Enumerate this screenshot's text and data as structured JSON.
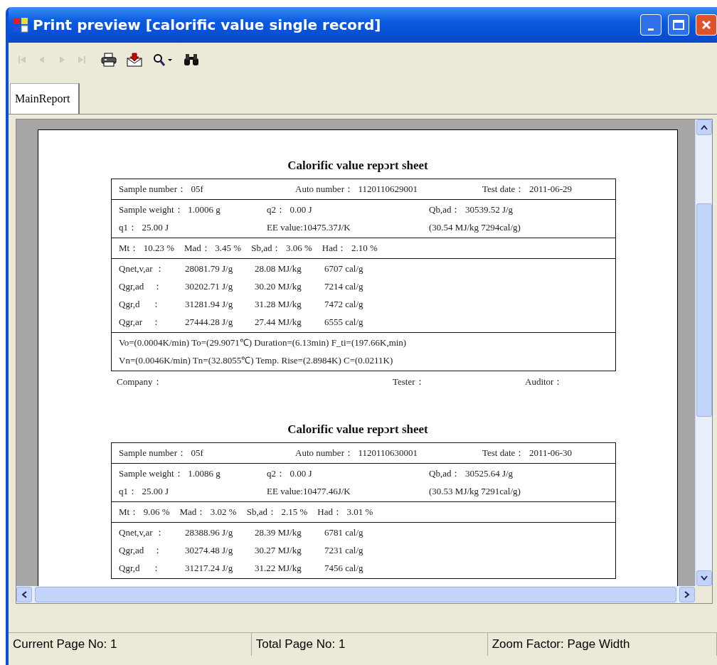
{
  "window": {
    "title": "Print preview [calorific value single record]"
  },
  "toolbar": [
    {
      "kind": "first",
      "disabled": true
    },
    {
      "kind": "prev",
      "disabled": true
    },
    {
      "kind": "next",
      "disabled": true
    },
    {
      "kind": "last",
      "disabled": true
    },
    {
      "kind": "print",
      "disabled": false
    },
    {
      "kind": "export",
      "disabled": false
    },
    {
      "kind": "zoom",
      "disabled": false
    },
    {
      "kind": "find",
      "disabled": false
    }
  ],
  "tabs": [
    {
      "label": "MainReport",
      "selected": true
    }
  ],
  "reports": [
    {
      "title": "Calorific value repɔrt sheet",
      "header": [
        "Sample number：  05f",
        "Auto number：  1120110629001",
        "Test date：  2011-06-29"
      ],
      "weights": [
        [
          "Sample weight：  1.0006 g",
          "q2：  0.00 J",
          "Qb,ad：  30539.52 J/g"
        ],
        [
          "q1：  25.00 J",
          "EE value:10475.37J/K",
          "(30.54 MJ/kg 7294cal/g)"
        ]
      ],
      "moisture": [
        "Mt：  10.23 %",
        "Mad：  3.45 %",
        "Sb,ad：  3.06 %",
        "Had：  2.10 %"
      ],
      "heat": [
        [
          "Qnet,v,ar ：",
          "28081.79 J/g",
          "28.08 MJ/kg",
          "6707 cal/g"
        ],
        [
          "Qgr,ad    ：",
          "30202.71 J/g",
          "30.20 MJ/kg",
          "7214 cal/g"
        ],
        [
          "Qgr,d     ：",
          "31281.94 J/g",
          "31.28 MJ/kg",
          "7472 cal/g"
        ],
        [
          "Qgr,ar    ：",
          "27444.28 J/g",
          "27.44 MJ/kg",
          "6555 cal/g"
        ]
      ],
      "params": [
        "Vo=(0.0004K/min) To=(29.9071℃) Duration=(6.13min) F_ti=(197.66K,min)",
        "Vn=(0.0046K/min) Tn=(32.8055℃) Temp. Rise=(2.8984K) C=(0.0211K)"
      ],
      "footer": [
        "Company：",
        "Tester：",
        "Auditor："
      ]
    },
    {
      "title": "Calorific value repɔrt sheet",
      "header": [
        "Sample number：  05f",
        "Auto number：  1120110630001",
        "Test date：  2011-06-30"
      ],
      "weights": [
        [
          "Sample weight：  1.0086 g",
          "q2：  0.00 J",
          "Qb,ad：  30525.64 J/g"
        ],
        [
          "q1：  25.00 J",
          "EE value:10477.46J/K",
          "(30.53 MJ/kg 7291cal/g)"
        ]
      ],
      "moisture": [
        "Mt：  9.06 %",
        "Mad：  3.02 %",
        "Sb,ad：  2.15 %",
        "Had：  3.01 %"
      ],
      "heat": [
        [
          "Qnet,v,ar ：",
          "28388.96 J/g",
          "28.39 MJ/kg",
          "6781 cal/g"
        ],
        [
          "Qgr,ad    ：",
          "30274.48 J/g",
          "30.27 MJ/kg",
          "7231 cal/g"
        ],
        [
          "Qgr,d     ：",
          "31217.24 J/g",
          "31.22 MJ/kg",
          "7456 cal/g"
        ]
      ]
    }
  ],
  "status_bar": [
    "Current Page No: 1",
    "Total Page No: 1",
    "Zoom Factor: Page Width"
  ]
}
